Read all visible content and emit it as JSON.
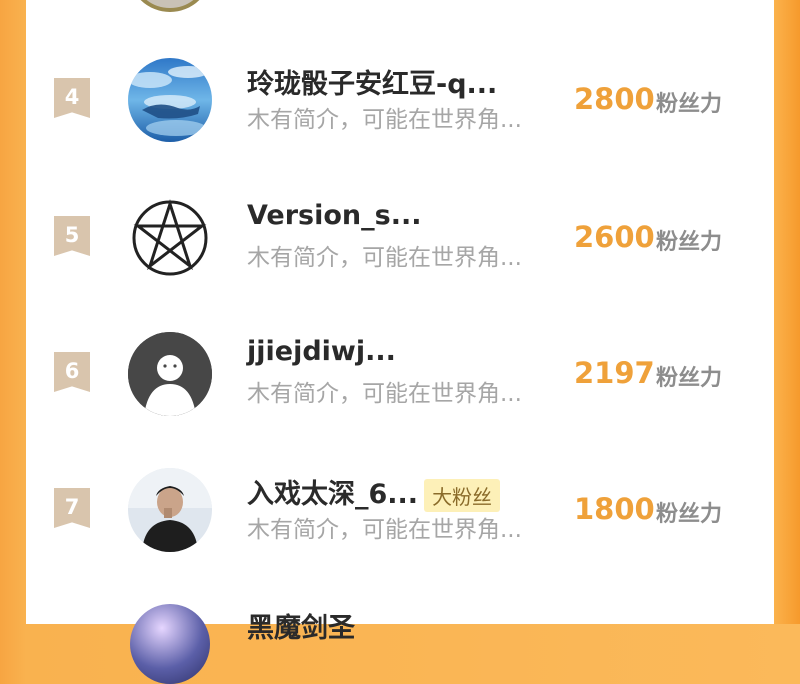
{
  "unit_label": "粉丝力",
  "rows": [
    {
      "rank": "4",
      "name": "玲珑骰子安红豆-q...",
      "bio": "木有简介，可能在世界角...",
      "count": "2800",
      "badge": ""
    },
    {
      "rank": "5",
      "name": "Version_s...",
      "bio": "木有简介，可能在世界角...",
      "count": "2600",
      "badge": ""
    },
    {
      "rank": "6",
      "name": "jjiejdiwj...",
      "bio": "木有简介，可能在世界角...",
      "count": "2197",
      "badge": ""
    },
    {
      "rank": "7",
      "name": "入戏太深_6...",
      "bio": "木有简介，可能在世界角...",
      "count": "1800",
      "badge": "大粉丝"
    }
  ],
  "next_row": {
    "name": "黑魔剑圣"
  },
  "colors": {
    "accent": "#efa13a",
    "rank_badge": "#d9c5ad",
    "background": "#f9b24f"
  }
}
